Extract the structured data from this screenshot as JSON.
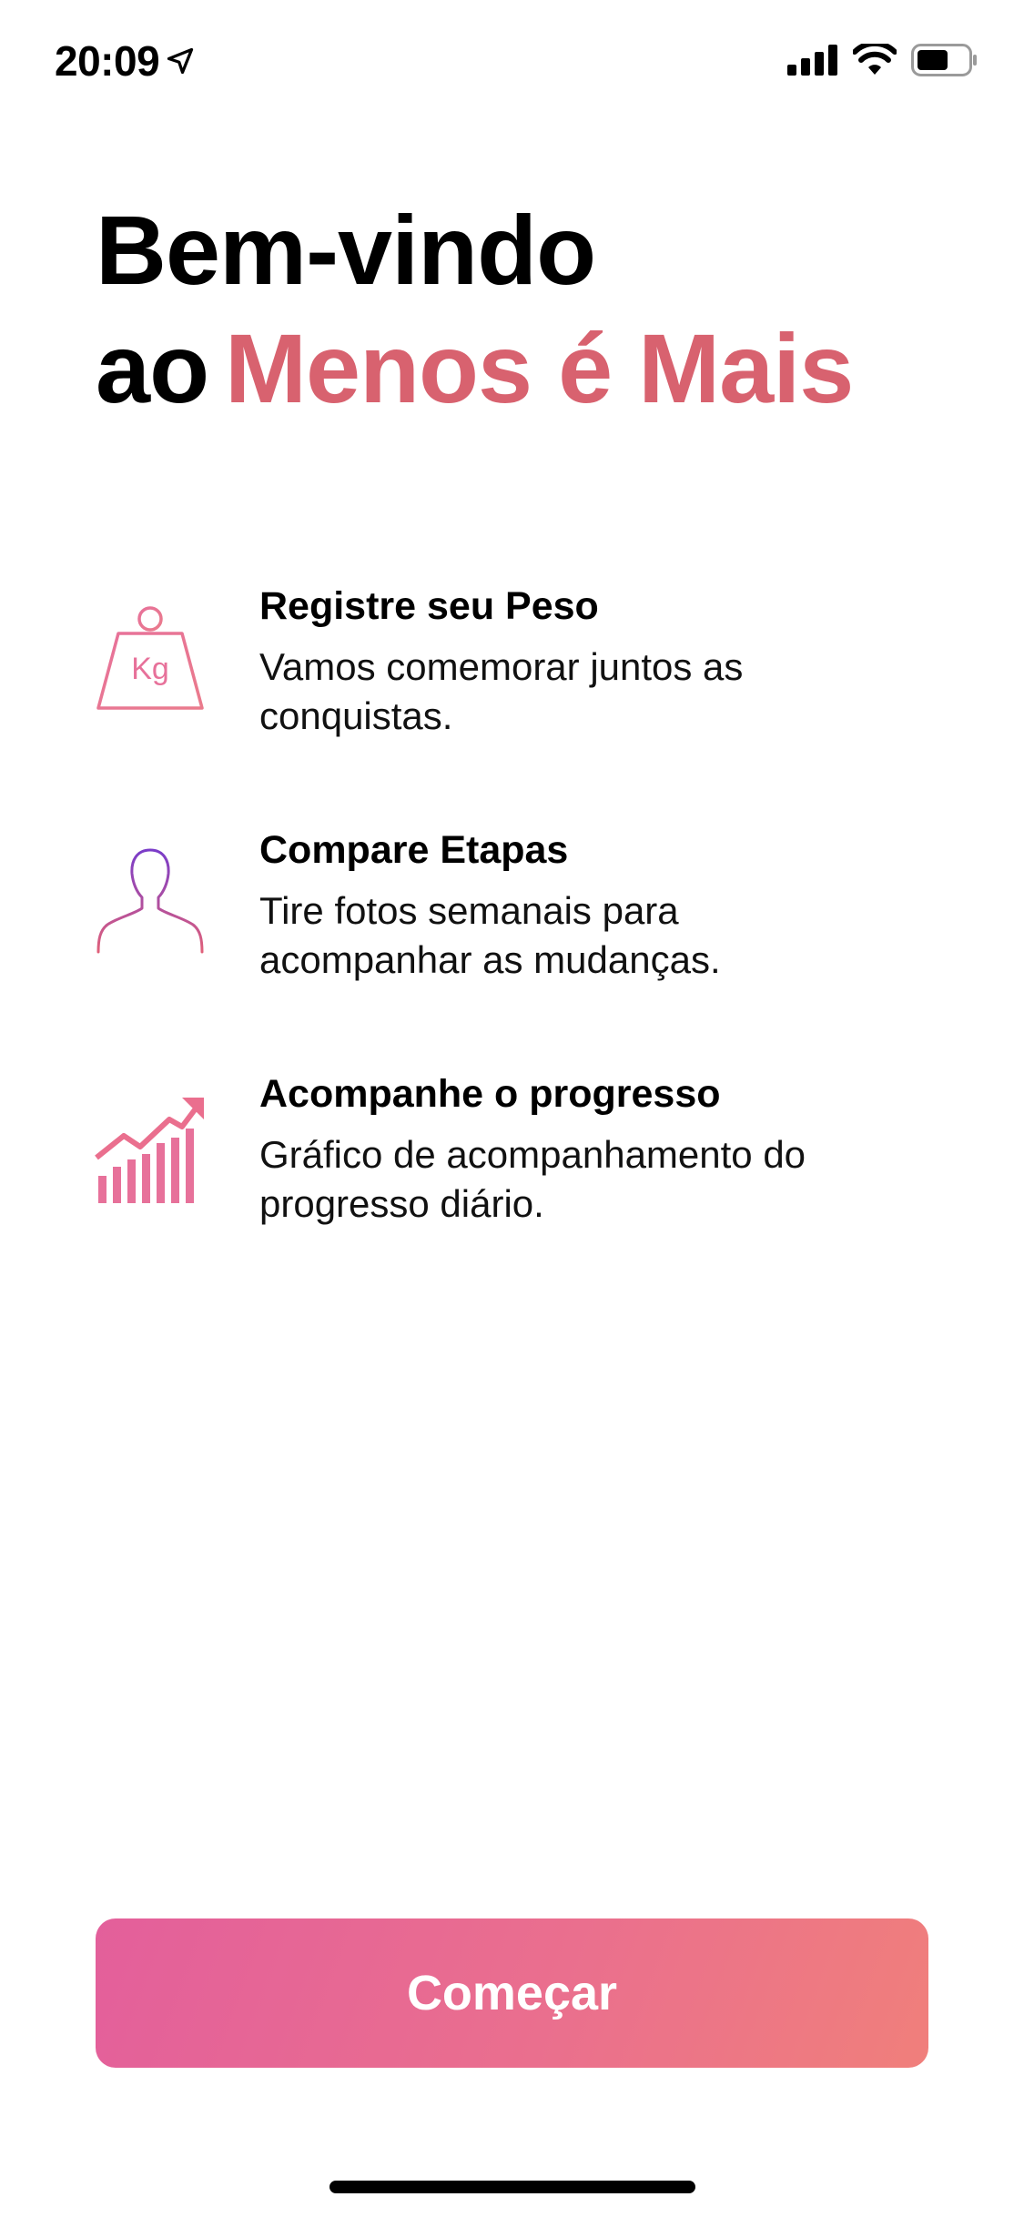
{
  "status_bar": {
    "time": "20:09",
    "icons": [
      "location-arrow-icon",
      "cellular-signal-icon",
      "wifi-icon",
      "battery-icon"
    ]
  },
  "title": {
    "line1": "Bem-vindo",
    "line2_prefix": "ao",
    "line2_accent": "Menos é Mais"
  },
  "features": [
    {
      "icon": "weight-kg-icon",
      "heading": "Registre seu Peso",
      "desc_line1": "Vamos comemorar juntos as",
      "desc_line2": "conquistas."
    },
    {
      "icon": "person-silhouette-icon",
      "heading": "Compare Etapas",
      "desc_line1": "Tire fotos semanais para",
      "desc_line2": "acompanhar as mudanças."
    },
    {
      "icon": "progress-chart-icon",
      "heading": "Acompanhe o progresso",
      "desc_line1": "Gráfico de acompanhamento do",
      "desc_line2": "progresso diário."
    }
  ],
  "weight_icon_label": "Kg",
  "cta": {
    "label": "Começar"
  },
  "colors": {
    "accent": "#d8626f",
    "button_gradient_start": "#e35f9b",
    "button_gradient_end": "#f07f7b",
    "icon_pink": "#e7719a",
    "icon_purple": "#7a3cc9"
  }
}
